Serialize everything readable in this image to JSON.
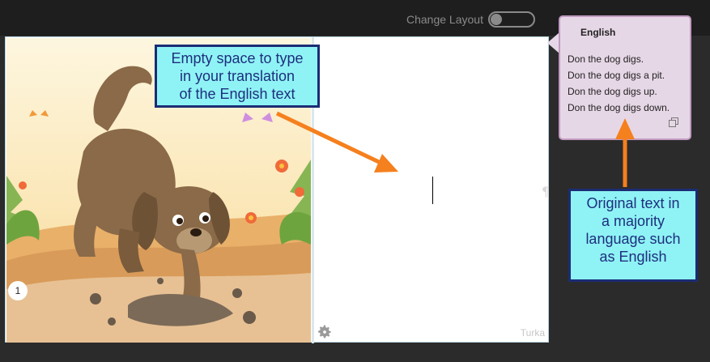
{
  "toolbar": {
    "change_layout_label": "Change Layout",
    "layout_toggle_on": false
  },
  "page": {
    "number": "1",
    "language_label": "Turka"
  },
  "source_bubble": {
    "title": "English",
    "lines": [
      "Don the dog digs.",
      "Don the dog digs a pit.",
      "Don the dog digs up.",
      "Don the dog digs down."
    ]
  },
  "callouts": {
    "left": {
      "lines": [
        "Empty space to type",
        "in your translation",
        "of the English text"
      ]
    },
    "right": {
      "lines": [
        "Original text in",
        "a majority",
        "language such",
        "as English"
      ]
    }
  },
  "colors": {
    "callout_fill": "#8ff3f5",
    "callout_border": "#1c2c74",
    "arrow": "#f5801e",
    "bubble_fill": "#e6d7e6"
  },
  "icons": {
    "gear": "gear-icon",
    "copy": "copy-icon",
    "pilcrow": "paragraph-mark-icon"
  }
}
